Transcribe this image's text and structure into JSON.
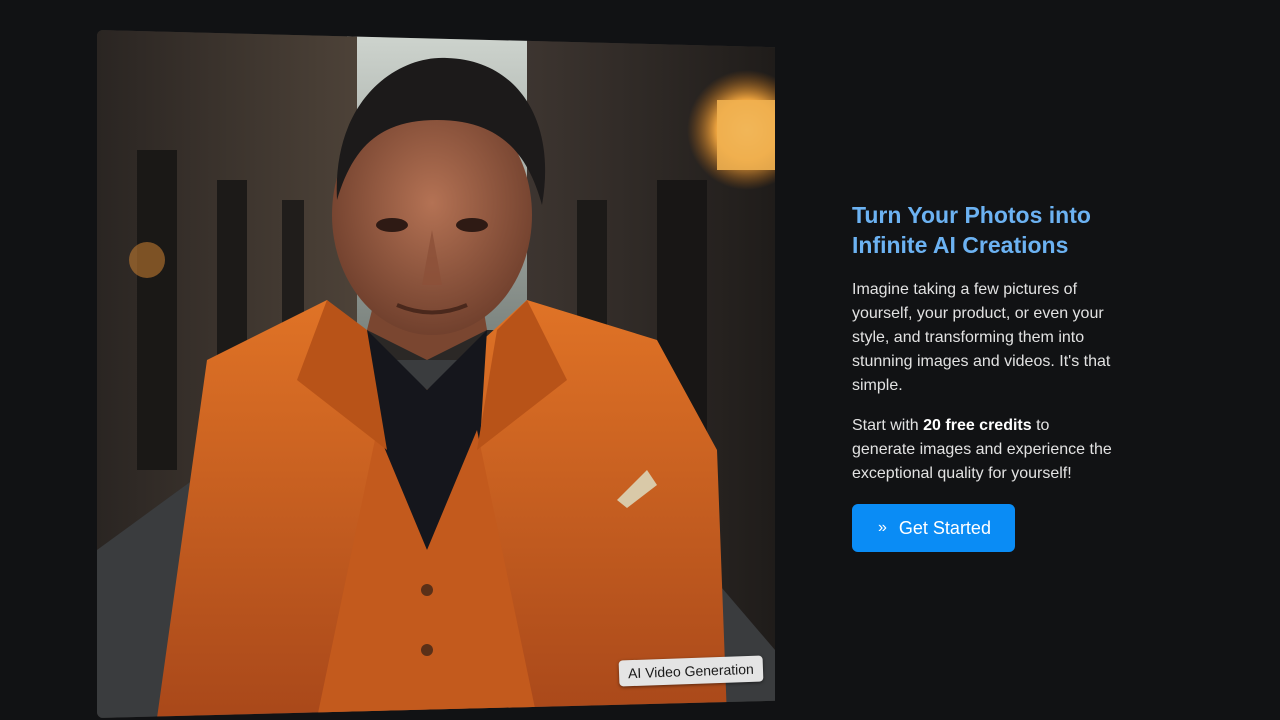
{
  "hero": {
    "image_alt": "Man in orange suit standing in a dim alley",
    "badge_label": "AI Video Generation"
  },
  "promo": {
    "title_line1": "Turn Your Photos into",
    "title_line2": "Infinite AI Creations",
    "paragraph1": "Imagine taking a few pictures of yourself, your product, or even your style, and transforming them into stunning images and videos. It's that simple.",
    "paragraph2_prefix": "Start with ",
    "paragraph2_bold": "20 free credits",
    "paragraph2_suffix": " to generate images and experience the exceptional quality for yourself!",
    "cta_label": "Get Started",
    "cta_icon": "double-chevron-right-icon"
  },
  "colors": {
    "background": "#111214",
    "title": "#6cb2f2",
    "cta": "#0a8cf5",
    "suit": "#d4641c"
  }
}
